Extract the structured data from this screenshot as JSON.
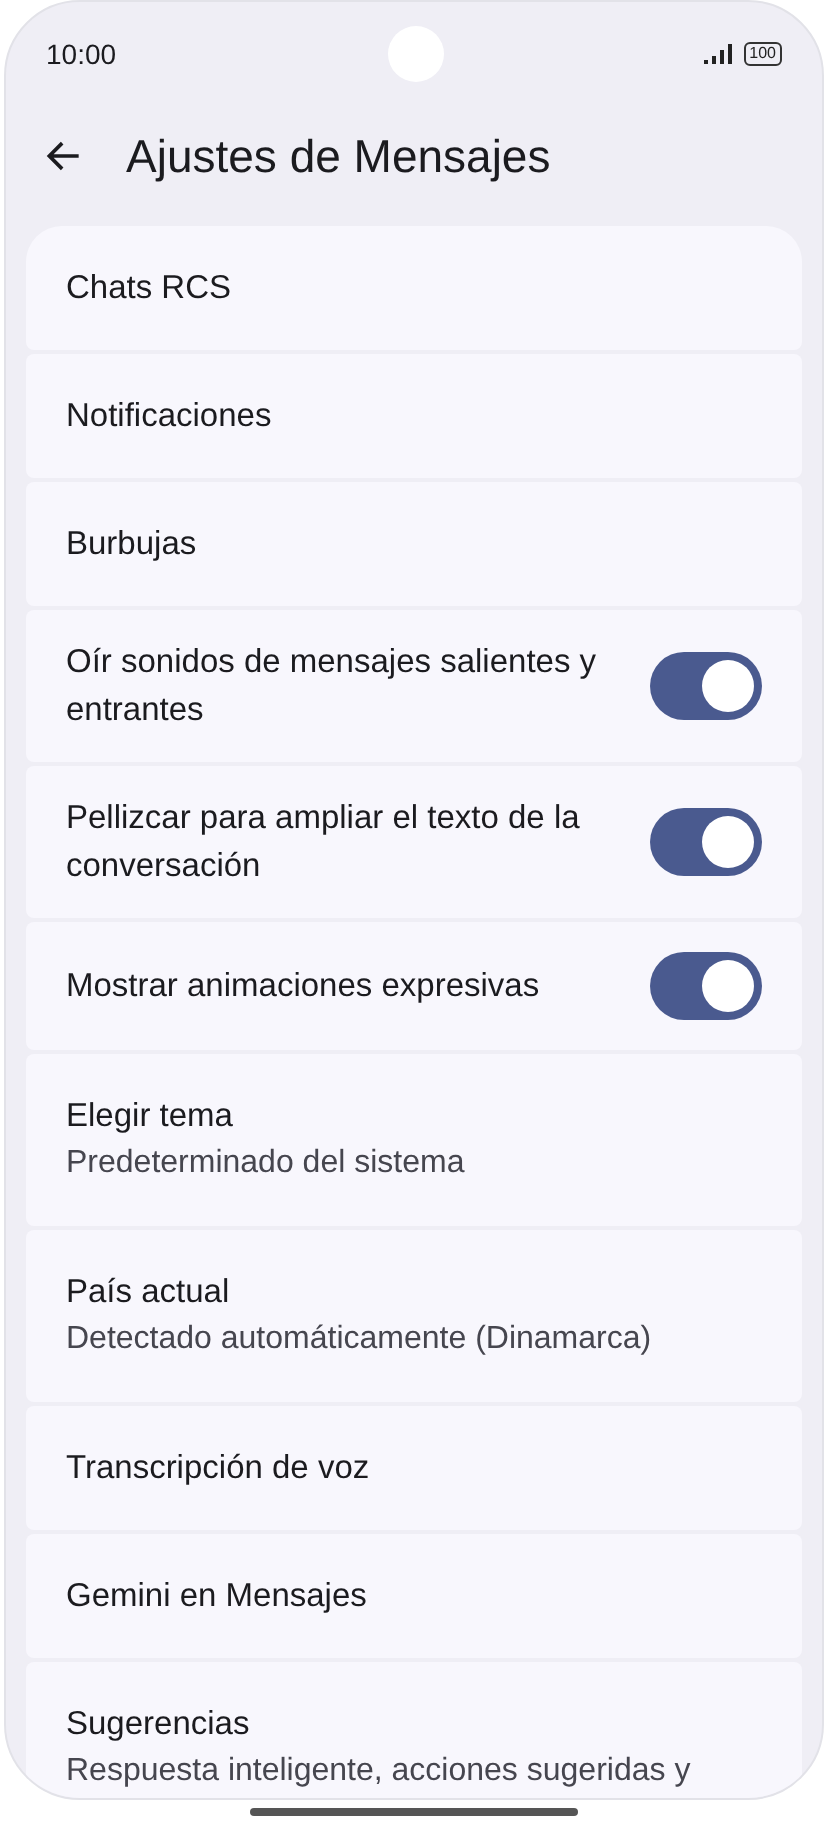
{
  "status_bar": {
    "time": "10:00",
    "battery": "100"
  },
  "header": {
    "title": "Ajustes de Mensajes"
  },
  "settings": [
    {
      "kind": "link",
      "label": "Chats RCS"
    },
    {
      "kind": "link",
      "label": "Notificaciones"
    },
    {
      "kind": "link",
      "label": "Burbujas"
    },
    {
      "kind": "toggle",
      "label": "Oír sonidos de mensajes salientes y entrantes",
      "on": true
    },
    {
      "kind": "toggle",
      "label": "Pellizcar para ampliar el texto de la conversación",
      "on": true
    },
    {
      "kind": "toggle",
      "label": "Mostrar animaciones expresivas",
      "on": true
    },
    {
      "kind": "detail",
      "label": "Elegir tema",
      "value": "Predeterminado del sistema"
    },
    {
      "kind": "detail",
      "label": "País actual",
      "value": "Detectado automáticamente (Dinamarca)"
    },
    {
      "kind": "link",
      "label": "Transcripción de voz"
    },
    {
      "kind": "link",
      "label": "Gemini en Mensajes"
    },
    {
      "kind": "detail",
      "label": "Sugerencias",
      "value": "Respuesta inteligente, acciones sugeridas y"
    }
  ]
}
